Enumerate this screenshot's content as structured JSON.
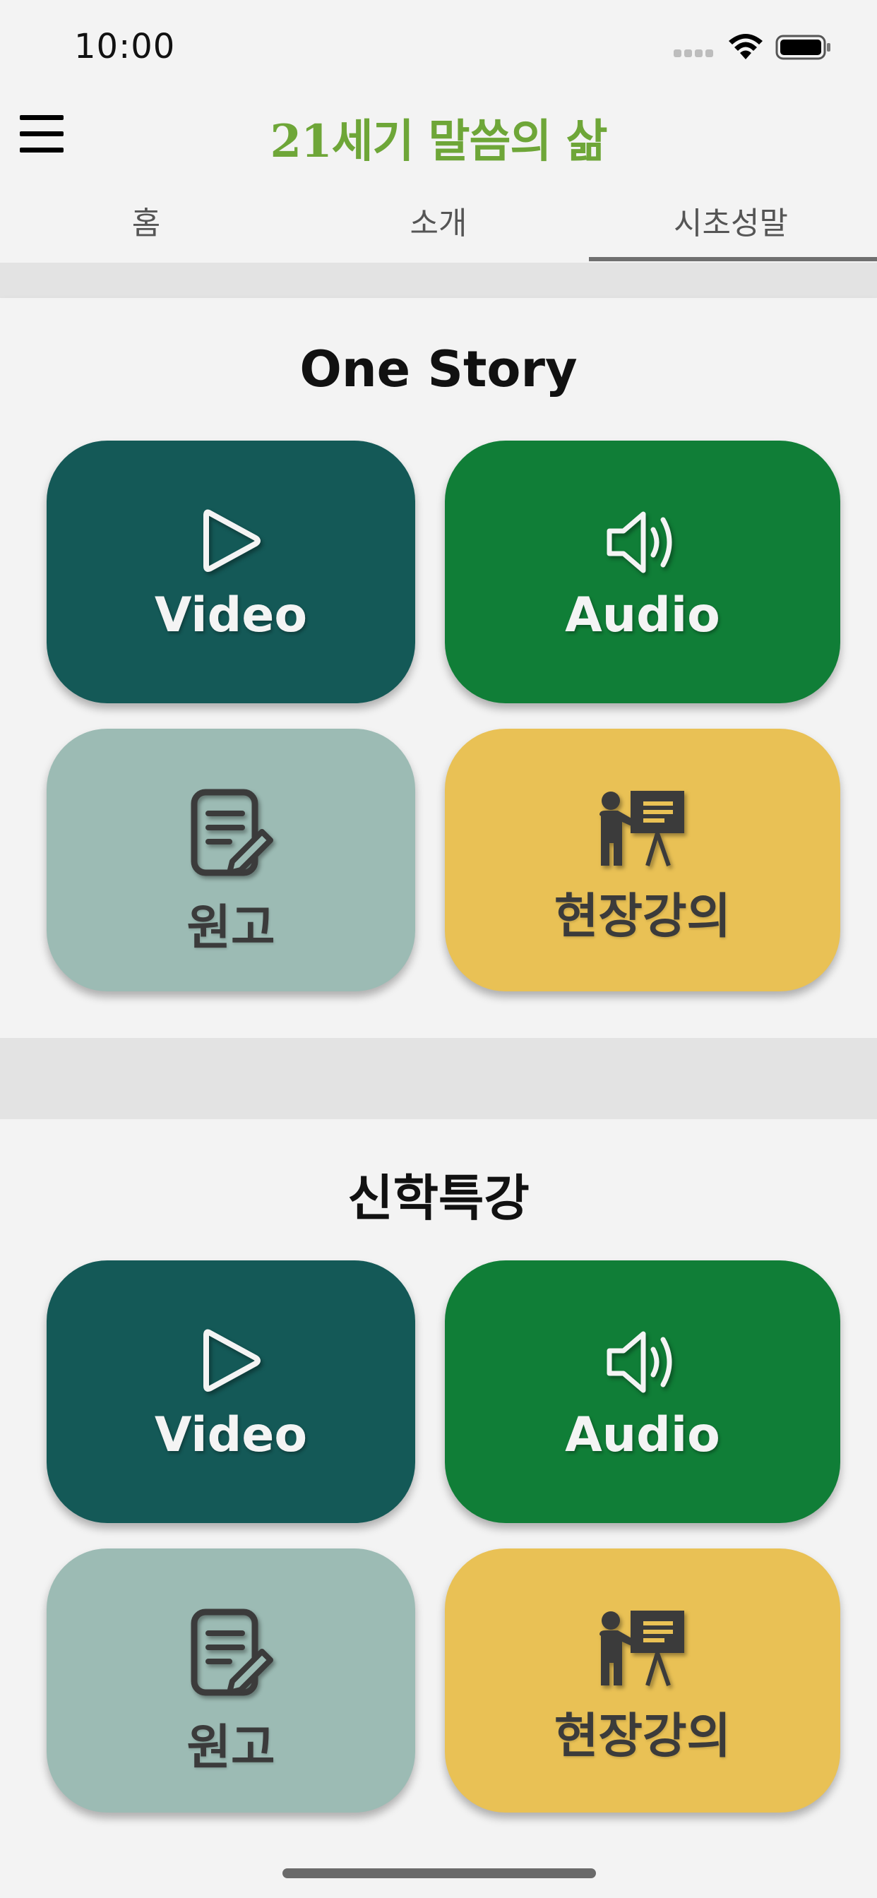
{
  "status_bar": {
    "time": "10:00"
  },
  "header": {
    "title": "21세기 말씀의 삶",
    "title_color": "#6ea638"
  },
  "tabs": [
    {
      "label": "홈",
      "active": false
    },
    {
      "label": "소개",
      "active": false
    },
    {
      "label": "시초성말",
      "active": true
    }
  ],
  "sections": [
    {
      "title": "One Story",
      "tiles": [
        {
          "label": "Video",
          "icon": "play-icon",
          "color": "#145957"
        },
        {
          "label": "Audio",
          "icon": "speaker-icon",
          "color": "#107e37"
        },
        {
          "label": "원고",
          "icon": "document-edit-icon",
          "color": "#9cbbb4"
        },
        {
          "label": "현장강의",
          "icon": "lecture-presenter-icon",
          "color": "#e9c155"
        }
      ]
    },
    {
      "title": "신학특강",
      "tiles": [
        {
          "label": "Video",
          "icon": "play-icon",
          "color": "#145957"
        },
        {
          "label": "Audio",
          "icon": "speaker-icon",
          "color": "#107e37"
        },
        {
          "label": "원고",
          "icon": "document-edit-icon",
          "color": "#9cbbb4"
        },
        {
          "label": "현장강의",
          "icon": "lecture-presenter-icon",
          "color": "#e9c155"
        }
      ]
    }
  ]
}
